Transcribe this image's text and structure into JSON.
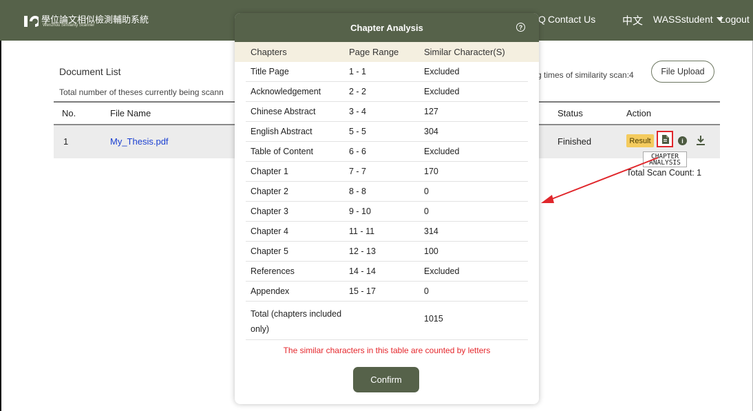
{
  "header": {
    "brand_cn": "學位論文相似檢測輔助系統",
    "brand_en": "Wenzhou Similarity Scanner",
    "faq_fragment": "Q",
    "contact": "Contact Us",
    "language": "中文",
    "user": "WASSstudent",
    "logout": "Logout"
  },
  "page": {
    "title": "Document List",
    "total_theses": "Total number of theses currently being scann",
    "scan_times": "g times of similarity scan:4",
    "upload_button": "File Upload",
    "columns": {
      "no": "No.",
      "file_name": "File Name",
      "status": "Status",
      "action": "Action"
    },
    "row": {
      "no": "1",
      "file_name": "My_Thesis.pdf",
      "status": "Finished",
      "result_button": "Result"
    },
    "tooltip_line1": "CHAPTER",
    "tooltip_line2": "ANALYSIS",
    "total_scan_count": "Total Scan Count: 1"
  },
  "modal": {
    "title": "Chapter Analysis",
    "columns": {
      "chapters": "Chapters",
      "page_range": "Page Range",
      "similar": "Similar Character(S)"
    },
    "rows": [
      {
        "chapter": "Title Page",
        "range": "1 - 1",
        "similar": "Excluded"
      },
      {
        "chapter": "Acknowledgement",
        "range": "2 - 2",
        "similar": "Excluded"
      },
      {
        "chapter": "Chinese Abstract",
        "range": "3 - 4",
        "similar": "127"
      },
      {
        "chapter": "English Abstract",
        "range": "5 - 5",
        "similar": "304"
      },
      {
        "chapter": "Table of Content",
        "range": "6 - 6",
        "similar": "Excluded"
      },
      {
        "chapter": "Chapter 1",
        "range": "7 - 7",
        "similar": "170"
      },
      {
        "chapter": "Chapter 2",
        "range": "8 - 8",
        "similar": "0"
      },
      {
        "chapter": "Chapter 3",
        "range": "9 - 10",
        "similar": "0"
      },
      {
        "chapter": "Chapter 4",
        "range": "11 - 11",
        "similar": "314"
      },
      {
        "chapter": "Chapter 5",
        "range": "12 - 13",
        "similar": "100"
      },
      {
        "chapter": "References",
        "range": "14 - 14",
        "similar": "Excluded"
      },
      {
        "chapter": "Appendex",
        "range": "15 - 17",
        "similar": "0"
      }
    ],
    "total_label": "Total (chapters included only)",
    "total_value": "1015",
    "note": "The similar characters in this table are counted by letters",
    "confirm": "Confirm"
  },
  "colors": {
    "header_bg": "#56624a",
    "table_head_bg": "#f4efe0",
    "note_red": "#e5262b",
    "result_yellow": "#f4cb5e",
    "link_blue": "#1a3fd1"
  }
}
